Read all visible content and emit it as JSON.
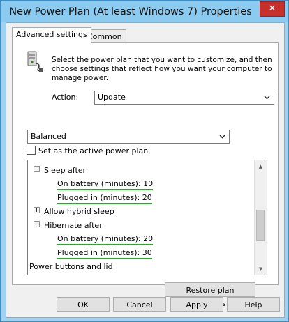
{
  "window": {
    "title": "New Power Plan (At least Windows 7) Properties",
    "close_glyph": "✕"
  },
  "tabs": [
    {
      "label": "Advanced settings",
      "active": true
    },
    {
      "label": "Common",
      "active": false
    }
  ],
  "description": "Select the power plan that you want to customize, and then choose settings that reflect how you want your computer to manage power.",
  "action": {
    "label": "Action:",
    "value": "Update"
  },
  "plan_select": {
    "value": "Balanced"
  },
  "active_checkbox": {
    "label": "Set as the active power plan",
    "checked": false
  },
  "tree": {
    "items": [
      {
        "label": "Sleep after",
        "type": "group",
        "expanded": true
      },
      {
        "label": "On battery (minutes): 10",
        "type": "setting"
      },
      {
        "label": "Plugged in (minutes): 20",
        "type": "setting"
      },
      {
        "label": "Allow hybrid sleep",
        "type": "group",
        "expanded": false
      },
      {
        "label": "Hibernate after",
        "type": "group",
        "expanded": true
      },
      {
        "label": "On battery (minutes): 20",
        "type": "setting"
      },
      {
        "label": "Plugged in (minutes): 30",
        "type": "setting"
      },
      {
        "label": "Power buttons and lid",
        "type": "group",
        "expanded": false
      }
    ],
    "scroll_position": 0.5
  },
  "buttons": {
    "restore": "Restore plan defaults",
    "ok": "OK",
    "cancel": "Cancel",
    "apply": "Apply",
    "help": "Help"
  },
  "colors": {
    "title_bar": "#8ccbf0",
    "close_button": "#c7302a",
    "highlight_underline": "#2aa82a"
  },
  "icons": {
    "plan": "power-plug-icon",
    "dropdown": "chevron-down-icon",
    "scroll_up": "scroll-up-arrow-icon",
    "scroll_down": "scroll-down-arrow-icon",
    "collapse": "minus-expander-icon",
    "expand": "plus-expander-icon"
  }
}
